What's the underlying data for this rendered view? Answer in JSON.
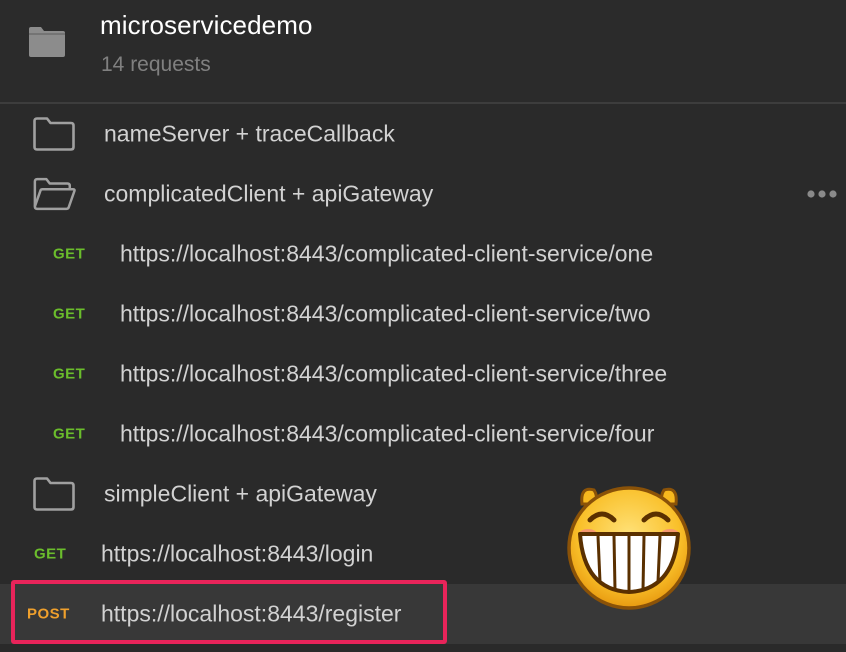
{
  "collection": {
    "name": "microservicedemo",
    "count": "14 requests",
    "icon": "folder-icon"
  },
  "items": [
    {
      "type": "folder",
      "label": "nameServer + traceCallback",
      "open": false
    },
    {
      "type": "folder",
      "label": "complicatedClient + apiGateway",
      "open": true,
      "more_icon": "more-dots-icon"
    },
    {
      "type": "request",
      "method": "GET",
      "label": "https://localhost:8443/complicated-client-service/one"
    },
    {
      "type": "request",
      "method": "GET",
      "label": "https://localhost:8443/complicated-client-service/two"
    },
    {
      "type": "request",
      "method": "GET",
      "label": "https://localhost:8443/complicated-client-service/three"
    },
    {
      "type": "request",
      "method": "GET",
      "label": "https://localhost:8443/complicated-client-service/four"
    },
    {
      "type": "folder",
      "label": "simpleClient + apiGateway",
      "open": false
    },
    {
      "type": "request",
      "method": "GET",
      "label": "https://localhost:8443/login"
    },
    {
      "type": "request",
      "method": "POST",
      "label": "https://localhost:8443/register",
      "selected": true
    }
  ],
  "colors": {
    "background": "#2a2a2a",
    "get": "#6bbd2c",
    "post": "#f0a02c",
    "highlight_border": "#e8245a"
  },
  "overlay": {
    "icon": "grinning-face-emoji"
  }
}
